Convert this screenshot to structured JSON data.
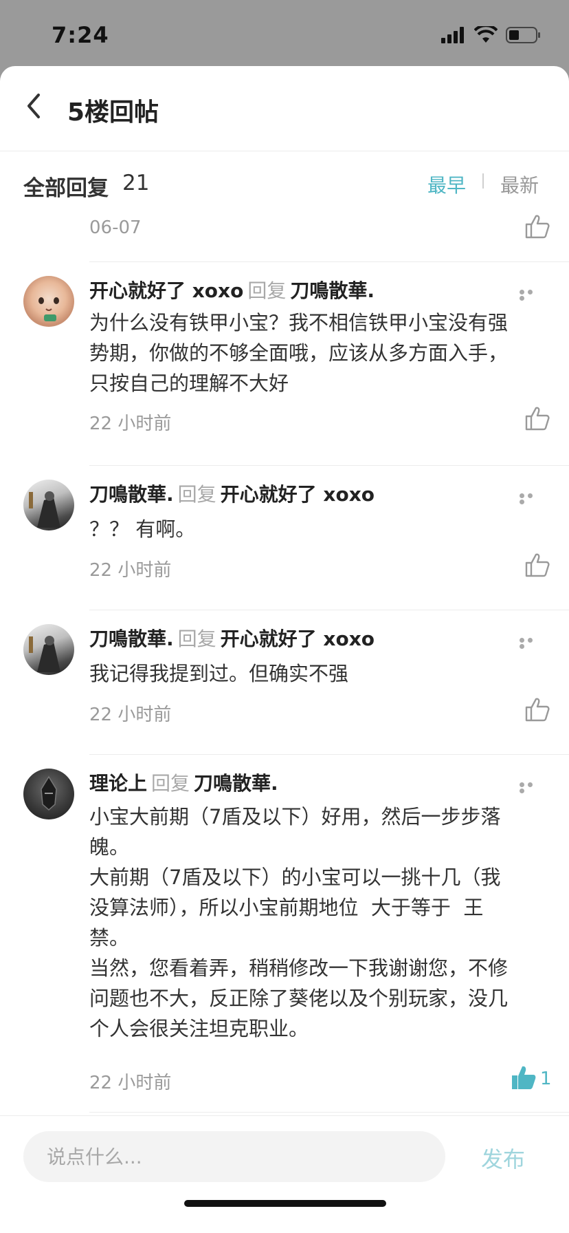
{
  "status_bar": {
    "time": "7:24"
  },
  "header": {
    "title": "5楼回帖"
  },
  "replies": {
    "title": "全部回复",
    "count": "21",
    "sort_earliest": "最早",
    "sort_latest": "最新"
  },
  "top_item": {
    "date": "06-07"
  },
  "comments": [
    {
      "author": "开心就好了 xoxo",
      "reply_word": "回复",
      "target": "刀鳴散華.",
      "lines": [
        "为什么没有铁甲小宝？我不相信铁甲小宝没有强",
        "势期，你做的不够全面哦，应该从多方面入手，",
        "只按自己的理解不大好"
      ],
      "time": "22 小时前"
    },
    {
      "author": "刀鳴散華.",
      "reply_word": "回复",
      "target": "开心就好了 xoxo",
      "lines": [
        "？？ 有啊。"
      ],
      "time": "22 小时前"
    },
    {
      "author": "刀鳴散華.",
      "reply_word": "回复",
      "target": "开心就好了 xoxo",
      "lines": [
        "我记得我提到过。但确实不强"
      ],
      "time": "22 小时前"
    },
    {
      "author": "理论上",
      "reply_word": "回复",
      "target": "刀鳴散華.",
      "lines": [
        "小宝大前期（7盾及以下）好用，然后一步步落",
        "魄。",
        "大前期（7盾及以下）的小宝可以一挑十几（我",
        "没算法师），所以小宝前期地位  大于等于  王",
        "禁。",
        "当然，您看着弄，稍稍修改一下我谢谢您，不修",
        "问题也不大，反正除了葵佬以及个别玩家，没几",
        "个人会很关注坦克职业。"
      ],
      "time": "22 小时前",
      "likes": "1"
    }
  ],
  "compose": {
    "placeholder": "说点什么...",
    "publish_label": "发布"
  },
  "colors": {
    "accent": "#4fb6c4",
    "muted": "#9a9a9a",
    "text": "#333333"
  }
}
